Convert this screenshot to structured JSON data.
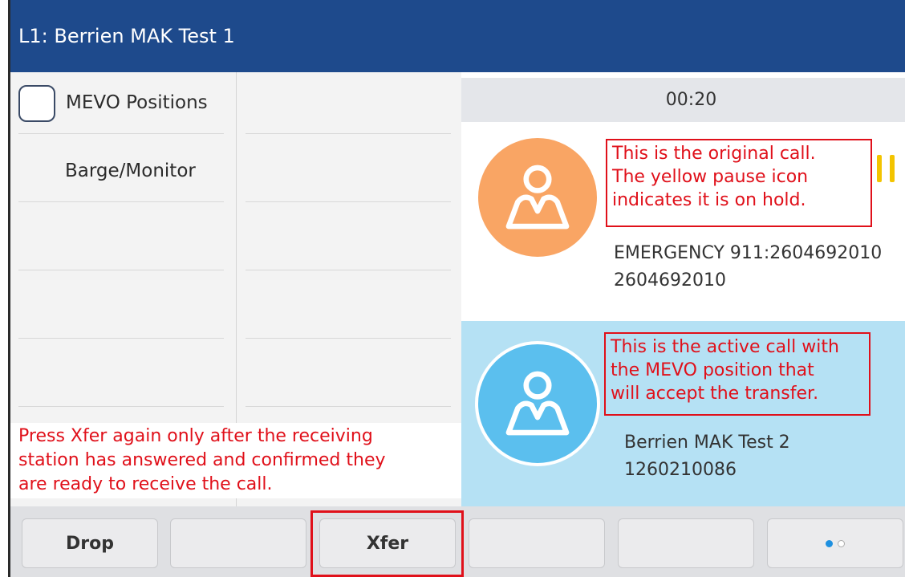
{
  "header": {
    "title": "L1: Berrien MAK Test 1"
  },
  "left_panel": {
    "checkbox_label": "MEVO Positions",
    "item_label": "Barge/Monitor",
    "note_lines": [
      "Press Xfer again only after the receiving",
      "station has answered and confirmed they",
      "are ready to receive the call."
    ]
  },
  "right_panel": {
    "timer": "00:20",
    "calls": [
      {
        "name": "EMERGENCY 911:2604692010",
        "number": "2604692010",
        "status": "on-hold",
        "annotation_lines": [
          "This is the original call.",
          "The yellow pause icon",
          "indicates it is on hold."
        ]
      },
      {
        "name": "Berrien MAK Test 2",
        "number": "1260210086",
        "status": "active",
        "annotation_lines": [
          "This is the active call with",
          "the MEVO position that",
          "will accept the transfer."
        ]
      }
    ]
  },
  "softkeys": [
    {
      "label": "Drop"
    },
    {
      "label": ""
    },
    {
      "label": "Xfer"
    },
    {
      "label": ""
    },
    {
      "label": ""
    },
    {
      "label": ""
    }
  ],
  "icons": {
    "avatar_hold": "user-avatar-icon",
    "avatar_active": "user-avatar-icon",
    "hold": "pause-icon",
    "paging": "page-indicator-dots"
  },
  "colors": {
    "header_bg": "#1e4a8c",
    "hold_avatar": "#f9a564",
    "active_avatar": "#5bbfee",
    "active_call_bg": "#b5e1f4",
    "annotation_red": "#e0101a",
    "pause_yellow": "#f3c400",
    "page_dot_active": "#1e90e0"
  }
}
